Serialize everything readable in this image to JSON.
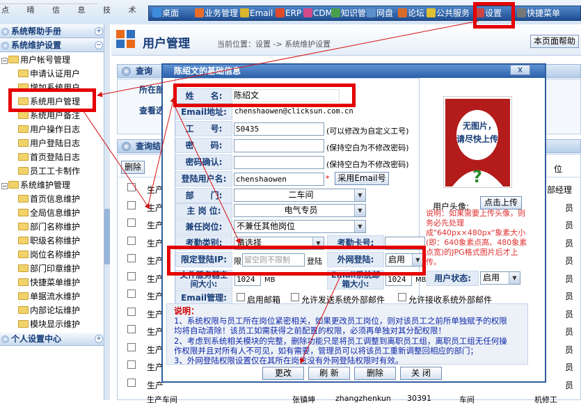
{
  "topbar": {
    "logo_tagline": "点 晴 信 息 技 术",
    "menu": [
      {
        "label": "桌面",
        "icon": "desktop-icon"
      },
      {
        "label": "业务管理",
        "icon": "business-icon"
      },
      {
        "label": "Email",
        "icon": "email-icon"
      },
      {
        "label": "ERP",
        "icon": "erp-icon"
      },
      {
        "label": "CDM",
        "icon": "cdm-icon"
      },
      {
        "label": "知识管理",
        "icon": "knowledge-icon"
      },
      {
        "label": "网盘",
        "icon": "netdisk-icon"
      },
      {
        "label": "论坛",
        "icon": "forum-icon"
      },
      {
        "label": "公共服务",
        "icon": "public-service-icon"
      },
      {
        "label": "设置",
        "icon": "settings-icon"
      },
      {
        "label": "快捷菜单",
        "icon": "shortcut-icon"
      }
    ]
  },
  "sidebar": {
    "section_help": "系统帮助手册",
    "section_maint": "系统维护设置",
    "group_accounts": "用户帐号管理",
    "account_items": [
      "申请认证用户",
      "增加系统用户",
      "系统用户管理",
      "系统用户备注",
      "用户操作日志",
      "用户登陆日志",
      "首页登陆日志",
      "员工工卡制作"
    ],
    "group_maint": "系统维护管理",
    "maint_items": [
      "首页信息维护",
      "全局信息维护",
      "部门名称维护",
      "职级名称维护",
      "岗位名称维护",
      "部门印章维护",
      "快捷菜单维护",
      "单据流水维护",
      "内部论坛维护",
      "模块显示维护"
    ],
    "section_personal": "个人设置中心"
  },
  "main": {
    "title": "用户管理",
    "breadcrumb": "当前位置：设置 -> 系统维护设置",
    "help_button": "本页面帮助",
    "query_panel_title": "查询",
    "query_labels": [
      "所在部门",
      "查看选项"
    ],
    "result_panel_title": "查询结果",
    "delete_button": "删除",
    "right_header": "位",
    "row_dept": "生产",
    "right_col_values": [
      "部经理",
      "员",
      "员",
      "员",
      "员",
      "员",
      "员",
      "员",
      "员",
      "员",
      "员",
      "员"
    ],
    "bottom_row_partial": [
      "生产车间",
      "张镇坤",
      "zhangzhenkun",
      "30391",
      "车间",
      "机修工"
    ]
  },
  "dialog": {
    "title": "陈绍文的基础信息",
    "close_label": "x",
    "fields": {
      "name_label": "姓　　名:",
      "name_value": "陈绍文",
      "email_label": "Email地址:",
      "email_value": "chenshaowen@clicksun.com.cn",
      "empno_label": "工　　号:",
      "empno_value": "S0435",
      "empno_hint": "(可以修改为自定义工号)",
      "password_label": "密　　码:",
      "password_hint": "(保持空白为不修改密码)",
      "password_confirm_label": "密码确认:",
      "password_confirm_hint": "(保持空白为不修改密码)",
      "login_label": "登陆用户名:",
      "login_value": "chenshaowen",
      "use_email_button": "采用Email号",
      "dept_label": "部　　门:",
      "dept_value": "二车间",
      "post_label": "主 岗 位:",
      "post_value": "电气专员",
      "extra_post_label": "兼任岗位:",
      "extra_post_value": "不兼任其他岗位",
      "attendance_type_label": "考勤类别:",
      "attendance_type_value": "请选择",
      "attendance_card_label": "考勤卡号:",
      "ip_label": "限定登陆IP:",
      "ip_prefix": "限",
      "ip_placeholder": "留空则不限制",
      "ip_suffix": "登陆",
      "external_login_label": "外网登陆:",
      "external_login_value": "启用",
      "storage_label": "文件服务器空间大小:",
      "storage_value": "1024",
      "storage_unit": "MB",
      "mailbox_label": "Email系统邮箱大小:",
      "mailbox_value": "1024",
      "mailbox_unit": "MB",
      "user_status_label": "用户状态:",
      "user_status_value": "启用",
      "email_mgmt_label": "Email管理:",
      "email_checks": [
        "启用邮箱",
        "允许发送系统外部邮件",
        "允许接收系统外部邮件"
      ]
    },
    "photo": {
      "no_image_line1": "无图片，",
      "no_image_line2": "请尽快上传",
      "avatar_label": "用户头像:",
      "upload_button": "点击上传",
      "note": "说明：如果需要上传头像，则务必先处理成\"640px×480px\"象素大小(即：640象素点高、480象素点宽)的JPG格式图片后才上传。"
    },
    "notes_title": "说明：",
    "notes": [
      "1、系统权限与员工所在岗位紧密相关，如果更改员工岗位，则对该员工之前所单独赋予的权限",
      "均将自动清除！该员工如需获得之前配置的权限，必须再单独对其分配权限！",
      "2、考虑到系统相关模块的完整，删除功能只是将员工调整到离职员工组，离职员工组无任何操",
      "作权限并且对所有人不可见，如有需要，管理员可以将该员工重新调整回相应的部门；",
      "3、外网登陆权限设置仅在其所在岗位没有外网登陆权限时有效。"
    ],
    "buttons": [
      "更改",
      "刷 新",
      "删除",
      "关 闭"
    ]
  }
}
